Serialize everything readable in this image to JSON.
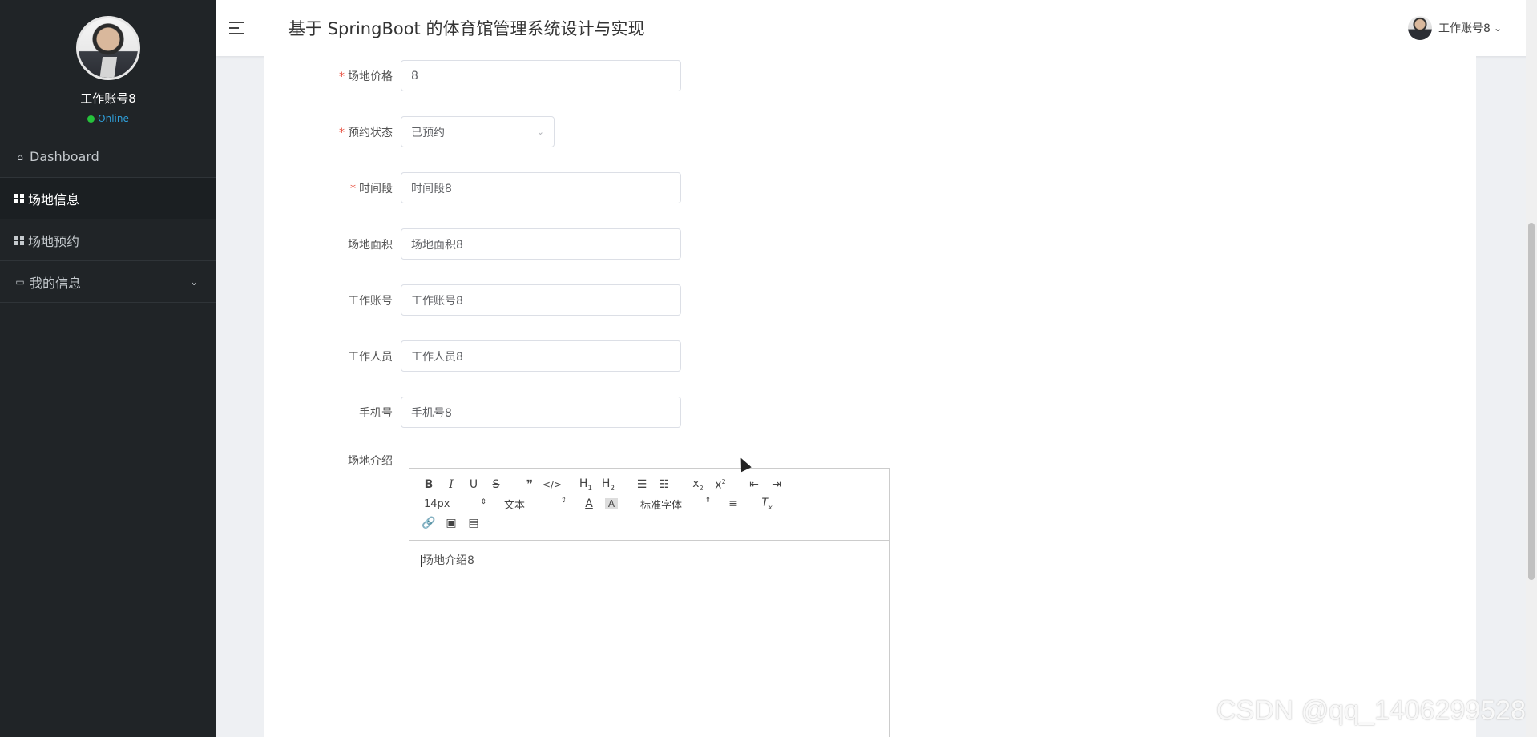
{
  "sidebar": {
    "username": "工作账号8",
    "status": "Online",
    "items": [
      {
        "label": "Dashboard"
      },
      {
        "label": "场地信息"
      },
      {
        "label": "场地预约"
      },
      {
        "label": "我的信息"
      }
    ]
  },
  "header": {
    "title": "基于 SpringBoot 的体育馆管理系统设计与实现",
    "user": "工作账号8"
  },
  "form": {
    "price": {
      "label": "场地价格",
      "value": "8"
    },
    "status": {
      "label": "预约状态",
      "value": "已预约"
    },
    "timeslot": {
      "label": "时间段",
      "value": "时间段8"
    },
    "area": {
      "label": "场地面积",
      "value": "场地面积8"
    },
    "account": {
      "label": "工作账号",
      "value": "工作账号8"
    },
    "staff": {
      "label": "工作人员",
      "value": "工作人员8"
    },
    "phone": {
      "label": "手机号",
      "value": "手机号8"
    },
    "intro": {
      "label": "场地介绍",
      "value": "场地介绍8"
    }
  },
  "editor": {
    "font_size": "14px",
    "block_type": "文本",
    "font_family": "标准字体"
  },
  "watermark": "CSDN @qq_1406299528",
  "colors": {
    "sidebar_bg": "#202427",
    "online_dot": "#25c23b",
    "required": "#e74c3c"
  }
}
